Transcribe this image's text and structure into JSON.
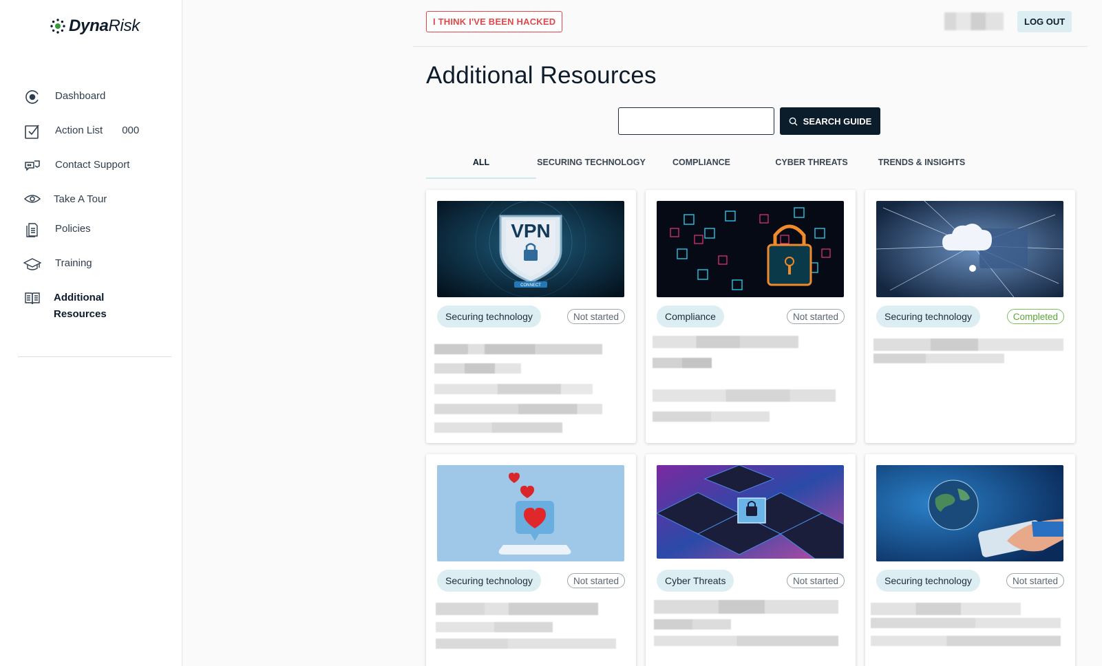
{
  "brand": {
    "name_bold": "Dyna",
    "name_light": "Risk"
  },
  "sidebar": {
    "items": [
      {
        "label": "Dashboard",
        "icon": "dashboard-icon"
      },
      {
        "label": "Action List",
        "count": "000",
        "icon": "checklist-icon"
      },
      {
        "label": "Contact Support",
        "icon": "support-chat-icon"
      },
      {
        "label": "Take A Tour",
        "icon": "eye-icon"
      },
      {
        "label": "Policies",
        "icon": "document-icon"
      },
      {
        "label": "Training",
        "icon": "graduation-cap-icon"
      },
      {
        "label": "Additional Resources",
        "icon": "book-icon",
        "active": true
      }
    ]
  },
  "header": {
    "hacked_label": "I THINK I'VE BEEN HACKED",
    "logout_label": "LOG OUT"
  },
  "page": {
    "title": "Additional Resources",
    "search_value": "",
    "search_button": "SEARCH GUIDE"
  },
  "tabs": [
    {
      "label": "ALL",
      "active": true
    },
    {
      "label": "SECURING TECHNOLOGY"
    },
    {
      "label": "COMPLIANCE"
    },
    {
      "label": "CYBER THREATS"
    },
    {
      "label": "TRENDS & INSIGHTS"
    }
  ],
  "cards": [
    {
      "category": "Securing technology",
      "status": "Not started",
      "image": "vpn-shield-image"
    },
    {
      "category": "Compliance",
      "status": "Not started",
      "image": "circuit-padlock-image"
    },
    {
      "category": "Securing technology",
      "status": "Completed",
      "image": "cloud-network-image"
    },
    {
      "category": "Securing technology",
      "status": "Not started",
      "image": "phone-hearts-image"
    },
    {
      "category": "Cyber Threats",
      "status": "Not started",
      "image": "cube-padlock-image"
    },
    {
      "category": "Securing technology",
      "status": "Not started",
      "image": "globe-tablet-image"
    }
  ],
  "colors": {
    "accent_dark": "#0b1c2b",
    "alert_red": "#e0474a",
    "badge_bg": "#ddeef3",
    "completed_green": "#5aa53a"
  }
}
